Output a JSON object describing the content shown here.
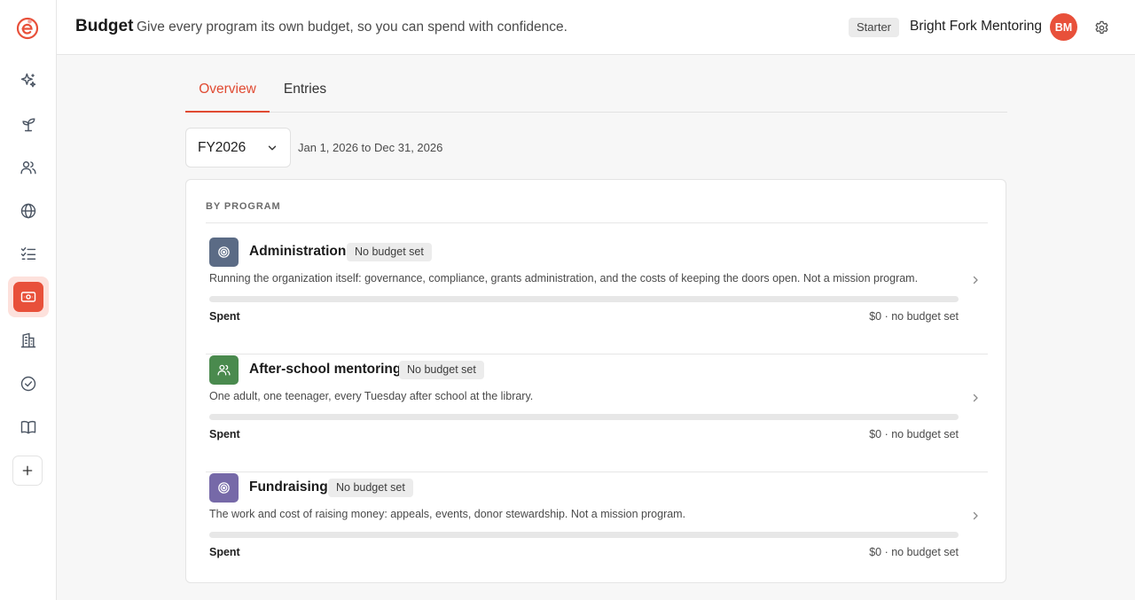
{
  "header": {
    "title": "Budget",
    "subtitle": "Give every program its own budget, so you can spend with confidence.",
    "plan": "Starter",
    "org_name": "Bright Fork Mentoring",
    "avatar_initials": "BM"
  },
  "sidebar": {
    "items": [
      {
        "icon": "sparkles-icon"
      },
      {
        "icon": "sprout-icon"
      },
      {
        "icon": "people-icon"
      },
      {
        "icon": "globe-icon"
      },
      {
        "icon": "checklist-icon"
      },
      {
        "icon": "budget-icon",
        "active": true
      },
      {
        "icon": "building-icon"
      },
      {
        "icon": "check-circle-icon"
      },
      {
        "icon": "book-icon"
      }
    ],
    "add_icon": "plus-icon"
  },
  "tabs": [
    {
      "label": "Overview",
      "active": true
    },
    {
      "label": "Entries",
      "active": false
    }
  ],
  "filter": {
    "year": "FY2026",
    "date_range": "Jan 1, 2026 to Dec 31, 2026"
  },
  "card": {
    "section_label": "BY PROGRAM",
    "programs": [
      {
        "name": "Administration",
        "badge": "No budget set",
        "description": "Running the organization itself: governance, compliance, grants administration, and the costs of keeping the doors open. Not a mission program.",
        "spent_label": "Spent",
        "amount": "$0 · no budget set",
        "progress": 0,
        "icon": "target-icon",
        "color": "#5b6b85"
      },
      {
        "name": "After-school mentoring",
        "badge": "No budget set",
        "description": "One adult, one teenager, every Tuesday after school at the library.",
        "spent_label": "Spent",
        "amount": "$0 · no budget set",
        "progress": 0,
        "icon": "people-icon",
        "color": "#4a8a4e"
      },
      {
        "name": "Fundraising",
        "badge": "No budget set",
        "description": "The work and cost of raising money: appeals, events, donor stewardship. Not a mission program.",
        "spent_label": "Spent",
        "amount": "$0 · no budget set",
        "progress": 0,
        "icon": "target-icon",
        "color": "#7669a8"
      }
    ]
  },
  "colors": {
    "accent": "#e8503a",
    "active_nav_bg": "#fde1dc"
  }
}
